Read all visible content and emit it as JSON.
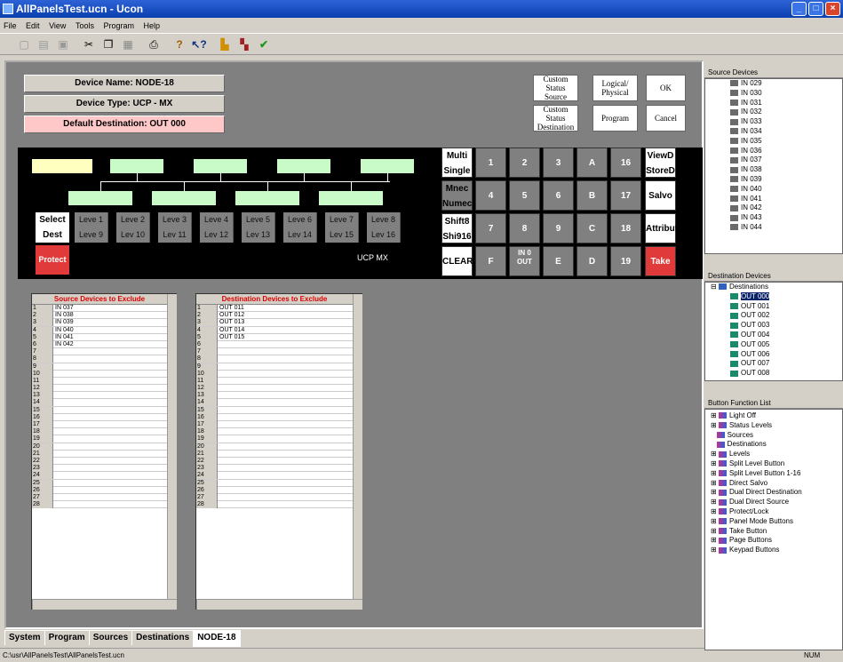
{
  "window": {
    "title": "AllPanelsTest.ucn - Ucon"
  },
  "menu": [
    "File",
    "Edit",
    "View",
    "Tools",
    "Program",
    "Help"
  ],
  "device": {
    "name": "Device Name: NODE-18",
    "type": "Device Type: UCP - MX",
    "default_dest": "Default Destination: OUT 000"
  },
  "buttons": {
    "csource": "Custom Status Source",
    "cdest": "Custom Status Destination",
    "logical": "Logical/ Physical",
    "program": "Program",
    "ok": "OK",
    "cancel": "Cancel"
  },
  "panel": {
    "select": "Select",
    "dest": "Dest",
    "protect": "Protect",
    "model": "UCP MX",
    "levels_top": [
      "Leve 1",
      "Leve 2",
      "Leve 3",
      "Leve 4",
      "Leve 5",
      "Leve 6",
      "Leve 7",
      "Leve 8"
    ],
    "levels_bot": [
      "Leve 9",
      "Lev 10",
      "Lev 11",
      "Lev 12",
      "Lev 13",
      "Lev 14",
      "Lev 15",
      "Lev 16"
    ],
    "mode": [
      [
        "Multi",
        "Single"
      ],
      [
        "Mnec",
        "Numec"
      ],
      [
        "Shift8",
        "Shi916"
      ],
      [
        "CLEAR",
        ""
      ]
    ],
    "keys": [
      [
        "1",
        "2",
        "3",
        "A",
        "16"
      ],
      [
        "4",
        "5",
        "6",
        "B",
        "17"
      ],
      [
        "7",
        "8",
        "9",
        "C",
        "18"
      ],
      [
        "F",
        "IN 0 OUT",
        "E",
        "D",
        "19"
      ]
    ],
    "right": [
      [
        "ViewD",
        "StoreD"
      ],
      [
        "Salvo",
        ""
      ],
      [
        "Attribut",
        ""
      ],
      [
        "Take",
        ""
      ]
    ]
  },
  "source_exclude": {
    "header": "Source Devices to Exclude",
    "rows": [
      "IN  037",
      "IN  038",
      "IN  039",
      "IN  040",
      "IN  041",
      "IN  042"
    ],
    "row_count": 28
  },
  "dest_exclude": {
    "header": "Destination Devices to Exclude",
    "rows": [
      "OUT 011",
      "OUT 012",
      "OUT 013",
      "OUT 014",
      "OUT 015"
    ],
    "row_count": 28
  },
  "tabs": [
    "System",
    "Program",
    "Sources",
    "Destinations",
    "NODE-18"
  ],
  "status": {
    "path": "C:\\usr\\AllPanelsTest\\AllPanelsTest.ucn",
    "num": "NUM"
  },
  "source_devices": {
    "title": "Source Devices",
    "items": [
      "IN  029",
      "IN  030",
      "IN  031",
      "IN  032",
      "IN  033",
      "IN  034",
      "IN  035",
      "IN  036",
      "IN  037",
      "IN  038",
      "IN  039",
      "IN  040",
      "IN  041",
      "IN  042",
      "IN  043",
      "IN  044"
    ]
  },
  "dest_devices": {
    "title": "Destination Devices",
    "root": "Destinations",
    "items": [
      "OUT 000",
      "OUT 001",
      "OUT 002",
      "OUT 003",
      "OUT 004",
      "OUT 005",
      "OUT 006",
      "OUT 007",
      "OUT 008"
    ]
  },
  "button_functions": {
    "title": "Button Function List",
    "items": [
      "Light Off",
      "Status Levels",
      "Sources",
      "Destinations",
      "Levels",
      "Split Level Button",
      "Split Level Button 1-16",
      "Direct Salvo",
      "Dual Direct Destination",
      "Dual Direct Source",
      "Protect/Lock",
      "Panel Mode Buttons",
      "Take Button",
      "Page Buttons",
      "Keypad Buttons"
    ]
  },
  "colors": {
    "title_bar": "#0a3fb0",
    "level_green": "#c8fbc8",
    "take_red": "#e03a3a",
    "default_dest_pink": "#ffc8c8",
    "dest_line_yellow": "#ffffc0"
  }
}
